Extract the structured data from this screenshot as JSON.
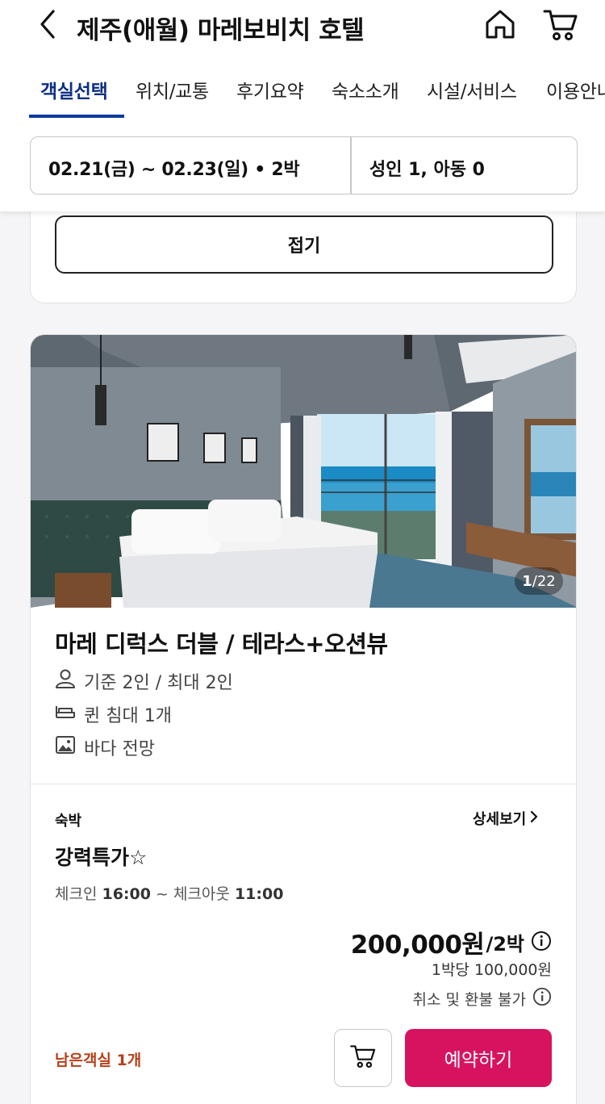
{
  "header": {
    "title": "제주(애월) 마레보비치 호텔",
    "back_icon": "chevron-left-icon",
    "home_icon": "home-icon",
    "cart_icon": "cart-icon"
  },
  "tabs": [
    {
      "label": "객실선택",
      "active": true
    },
    {
      "label": "위치/교통",
      "active": false
    },
    {
      "label": "후기요약",
      "active": false
    },
    {
      "label": "숙소소개",
      "active": false
    },
    {
      "label": "시설/서비스",
      "active": false
    },
    {
      "label": "이용안내",
      "active": false
    }
  ],
  "search": {
    "dates": "02.21(금) ~ 02.23(일) • 2박",
    "guests": "성인 1, 아동 0"
  },
  "fold": {
    "label": "접기"
  },
  "room": {
    "photo_counter_current": "1",
    "photo_counter_total": "/22",
    "name": "마레 디럭스 더블 / 테라스+오션뷰",
    "features": [
      {
        "icon": "person-icon",
        "text": "기준 2인 / 최대 2인"
      },
      {
        "icon": "bed-icon",
        "text": "퀸 침대 1개"
      },
      {
        "icon": "image-icon",
        "text": "바다 전망"
      }
    ],
    "plan": {
      "stay_type": "숙박",
      "detail_link": "상세보기",
      "name": "강력특가☆",
      "checkin_label": "체크인 ",
      "checkin_time": "16:00",
      "separator": " ~ ",
      "checkout_label": "체크아웃 ",
      "checkout_time": "11:00",
      "price": "200,000원",
      "price_unit": "/2박",
      "per_night": "1박당 100,000원",
      "refund_policy": "취소 및 환불 불가",
      "remaining": "남은객실 1개",
      "book_label": "예약하기"
    }
  },
  "colors": {
    "active_tab": "#0b2f85",
    "book_button": "#d7135f",
    "remaining_text": "#b5401b"
  }
}
